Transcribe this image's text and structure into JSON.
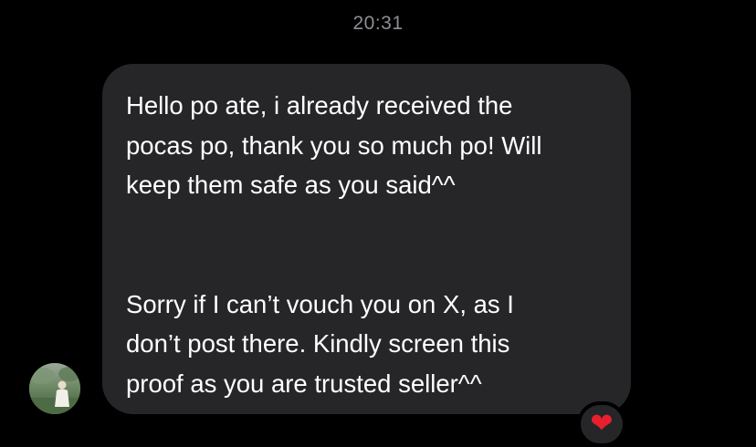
{
  "timestamp": "20:31",
  "message": {
    "paragraph_1": [
      "Hello po ate, i already received the",
      "pocas po, thank you so much po! Will",
      "keep them safe as you said^^"
    ],
    "paragraph_2": [
      "Sorry if I can’t vouch you on X, as I",
      "don’t post there. Kindly screen this",
      "proof as you are trusted seller^^"
    ]
  },
  "reaction": {
    "emoji": "❤",
    "icon": "red-heart-icon",
    "color": "#e8202e"
  },
  "avatar": {
    "icon": "contact-avatar-photo"
  },
  "colors": {
    "background": "#000000",
    "bubble": "#262628",
    "timestamp": "#8e8e93",
    "message_text": "#ffffff"
  }
}
